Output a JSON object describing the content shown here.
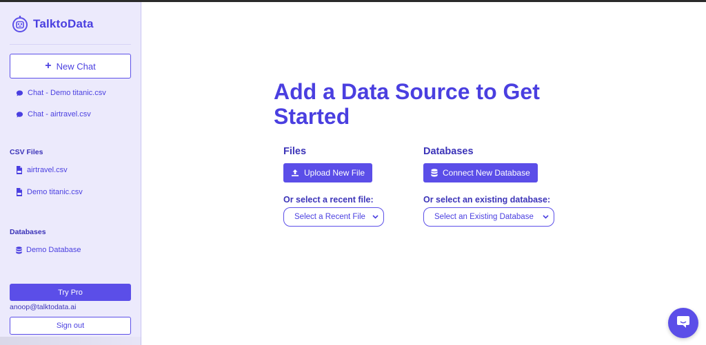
{
  "brand": {
    "name": "TalktoData",
    "accent": "#5b4ee8"
  },
  "sidebar": {
    "new_chat_label": "New Chat",
    "chats": [
      {
        "label": "Chat - Demo titanic.csv",
        "icon": "chat-icon"
      },
      {
        "label": "Chat - airtravel.csv",
        "icon": "chat-icon"
      }
    ],
    "csv_section_title": "CSV Files",
    "csv_files": [
      {
        "label": "airtravel.csv",
        "icon": "csv-file-icon"
      },
      {
        "label": "Demo titanic.csv",
        "icon": "csv-file-icon"
      }
    ],
    "db_section_title": "Databases",
    "databases": [
      {
        "label": "Demo Database",
        "icon": "database-icon"
      }
    ],
    "try_pro_label": "Try Pro",
    "user_email": "anoop@talktodata.ai",
    "sign_out_label": "Sign out"
  },
  "main": {
    "title": "Add a Data Source to Get Started",
    "files": {
      "title": "Files",
      "upload_label": "Upload New File",
      "recent_label": "Or select a recent file:",
      "recent_select": "Select a Recent File"
    },
    "databases": {
      "title": "Databases",
      "connect_label": "Connect New Database",
      "existing_label": "Or select an existing database:",
      "existing_select": "Select an Existing Database"
    }
  }
}
